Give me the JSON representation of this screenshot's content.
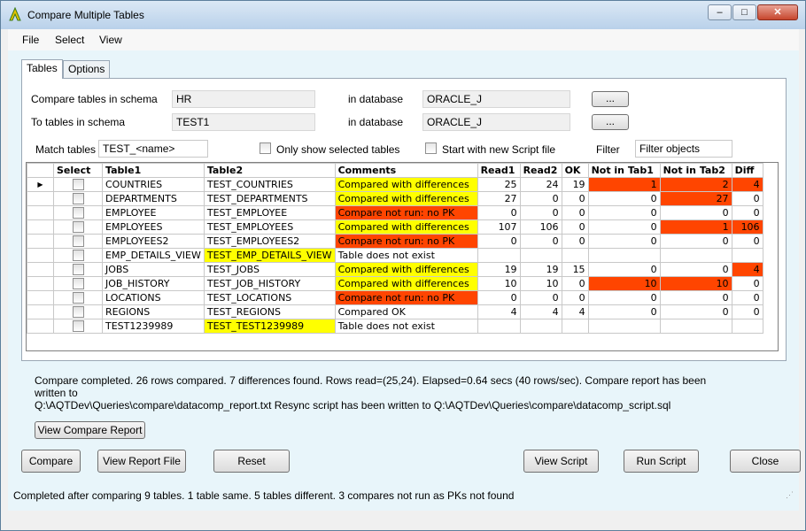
{
  "window": {
    "title": "Compare Multiple Tables",
    "min_symbol": "–",
    "max_symbol": "□",
    "close_symbol": "✕"
  },
  "menu": [
    "File",
    "Select",
    "View"
  ],
  "tabs": [
    {
      "label": "Tables",
      "active": true
    },
    {
      "label": "Options",
      "active": false
    }
  ],
  "form": {
    "compare_schema_label": "Compare tables in schema",
    "compare_schema_value": "HR",
    "compare_db_label": "in database",
    "compare_db_value": "ORACLE_J",
    "to_schema_label": "To tables in schema",
    "to_schema_value": "TEST1",
    "to_db_label": "in database",
    "to_db_value": "ORACLE_J",
    "browse_label": "...",
    "match_label": "Match tables",
    "match_value": "TEST_<name>",
    "only_selected_label": "Only show selected tables",
    "new_script_label": "Start with new Script file",
    "filter_label": "Filter",
    "filter_placeholder": "Filter objects"
  },
  "grid": {
    "columns": [
      "Select",
      "Table1",
      "Table2",
      "Comments",
      "Read1",
      "Read2",
      "OK",
      "Not in Tab1",
      "Not in Tab2",
      "Diff"
    ],
    "current_row_marker": "▶",
    "rows": [
      {
        "t1": "COUNTRIES",
        "t2": "TEST_COUNTRIES",
        "t2hl": "",
        "comment": "Compared with differences",
        "chl": "y",
        "r1": "25",
        "r2": "24",
        "ok": "19",
        "n1": "1",
        "n1hl": "r",
        "n2": "2",
        "n2hl": "r",
        "diff": "4",
        "dhl": "r"
      },
      {
        "t1": "DEPARTMENTS",
        "t2": "TEST_DEPARTMENTS",
        "t2hl": "",
        "comment": "Compared with differences",
        "chl": "y",
        "r1": "27",
        "r2": "0",
        "ok": "0",
        "n1": "0",
        "n1hl": "",
        "n2": "27",
        "n2hl": "r",
        "diff": "0",
        "dhl": ""
      },
      {
        "t1": "EMPLOYEE",
        "t2": "TEST_EMPLOYEE",
        "t2hl": "",
        "comment": "Compare not run: no PK",
        "chl": "r",
        "r1": "0",
        "r2": "0",
        "ok": "0",
        "n1": "0",
        "n1hl": "",
        "n2": "0",
        "n2hl": "",
        "diff": "0",
        "dhl": ""
      },
      {
        "t1": "EMPLOYEES",
        "t2": "TEST_EMPLOYEES",
        "t2hl": "",
        "comment": "Compared with differences",
        "chl": "y",
        "r1": "107",
        "r2": "106",
        "ok": "0",
        "n1": "0",
        "n1hl": "",
        "n2": "1",
        "n2hl": "r",
        "diff": "106",
        "dhl": "r"
      },
      {
        "t1": "EMPLOYEES2",
        "t2": "TEST_EMPLOYEES2",
        "t2hl": "",
        "comment": "Compare not run: no PK",
        "chl": "r",
        "r1": "0",
        "r2": "0",
        "ok": "0",
        "n1": "0",
        "n1hl": "",
        "n2": "0",
        "n2hl": "",
        "diff": "0",
        "dhl": ""
      },
      {
        "t1": "EMP_DETAILS_VIEW",
        "t2": "TEST_EMP_DETAILS_VIEW",
        "t2hl": "y",
        "comment": "Table does not exist",
        "chl": "",
        "r1": "",
        "r2": "",
        "ok": "",
        "n1": "",
        "n1hl": "",
        "n2": "",
        "n2hl": "",
        "diff": "",
        "dhl": ""
      },
      {
        "t1": "JOBS",
        "t2": "TEST_JOBS",
        "t2hl": "",
        "comment": "Compared with differences",
        "chl": "y",
        "r1": "19",
        "r2": "19",
        "ok": "15",
        "n1": "0",
        "n1hl": "",
        "n2": "0",
        "n2hl": "",
        "diff": "4",
        "dhl": "r"
      },
      {
        "t1": "JOB_HISTORY",
        "t2": "TEST_JOB_HISTORY",
        "t2hl": "",
        "comment": "Compared with differences",
        "chl": "y",
        "r1": "10",
        "r2": "10",
        "ok": "0",
        "n1": "10",
        "n1hl": "r",
        "n2": "10",
        "n2hl": "r",
        "diff": "0",
        "dhl": ""
      },
      {
        "t1": "LOCATIONS",
        "t2": "TEST_LOCATIONS",
        "t2hl": "",
        "comment": "Compare not run: no PK",
        "chl": "r",
        "r1": "0",
        "r2": "0",
        "ok": "0",
        "n1": "0",
        "n1hl": "",
        "n2": "0",
        "n2hl": "",
        "diff": "0",
        "dhl": ""
      },
      {
        "t1": "REGIONS",
        "t2": "TEST_REGIONS",
        "t2hl": "",
        "comment": "Compared OK",
        "chl": "",
        "r1": "4",
        "r2": "4",
        "ok": "4",
        "n1": "0",
        "n1hl": "",
        "n2": "0",
        "n2hl": "",
        "diff": "0",
        "dhl": ""
      },
      {
        "t1": "TEST1239989",
        "t2": "TEST_TEST1239989",
        "t2hl": "y",
        "comment": "Table does not exist",
        "chl": "",
        "r1": "",
        "r2": "",
        "ok": "",
        "n1": "",
        "n1hl": "",
        "n2": "",
        "n2hl": "",
        "diff": "",
        "dhl": ""
      }
    ]
  },
  "messages": {
    "line1": "Compare completed. 26 rows compared. 7 differences found. Rows read=(25,24). Elapsed=0.64 secs (40 rows/sec).   Compare report has been written to",
    "line2": "Q:\\AQTDev\\Queries\\compare\\datacomp_report.txt  Resync script has been written to Q:\\AQTDev\\Queries\\compare\\datacomp_script.sql"
  },
  "buttons": {
    "view_compare_report": "View Compare Report",
    "compare": "Compare",
    "view_report_file": "View Report File",
    "reset": "Reset",
    "view_script": "View Script",
    "run_script": "Run Script",
    "close": "Close"
  },
  "status": "Completed after comparing 9 tables. 1 table same. 5 tables different. 3 compares not run as PKs not found",
  "colors": {
    "highlight_yellow": "#ffff00",
    "highlight_red": "#ff4500"
  }
}
